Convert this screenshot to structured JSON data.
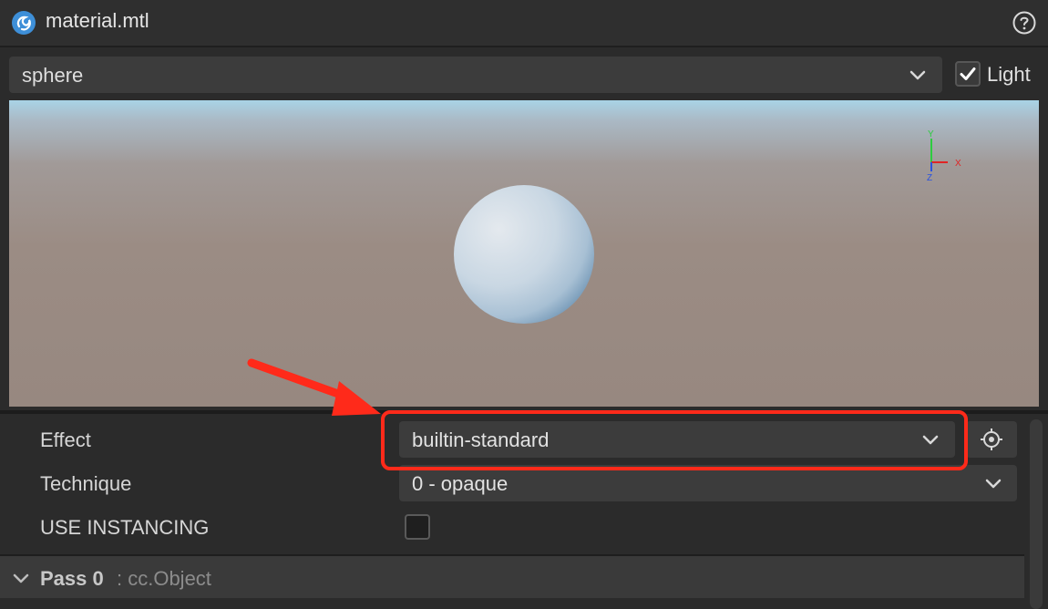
{
  "window": {
    "title": "material.mtl",
    "app_icon": "cocos-creator-icon",
    "help_icon": "help-icon"
  },
  "preview": {
    "model_select": {
      "value": "sphere",
      "icon": "chevron-down-icon"
    },
    "light_toggle": {
      "label": "Light",
      "checked": true
    },
    "axis_gizmo": {
      "y_label": "Y",
      "x_label": "X",
      "z_label": "Z"
    }
  },
  "properties": {
    "effect": {
      "label": "Effect",
      "value": "builtin-standard",
      "icon": "chevron-down-icon",
      "locate_icon": "locate-target-icon"
    },
    "technique": {
      "label": "Technique",
      "value": "0 - opaque",
      "icon": "chevron-down-icon"
    },
    "use_instancing": {
      "label": "USE INSTANCING",
      "checked": false
    }
  },
  "pass": {
    "title": "Pass 0",
    "type": ": cc.Object",
    "icon": "chevron-down-icon"
  },
  "annotation": {
    "highlight_color": "#ff2a1a"
  }
}
